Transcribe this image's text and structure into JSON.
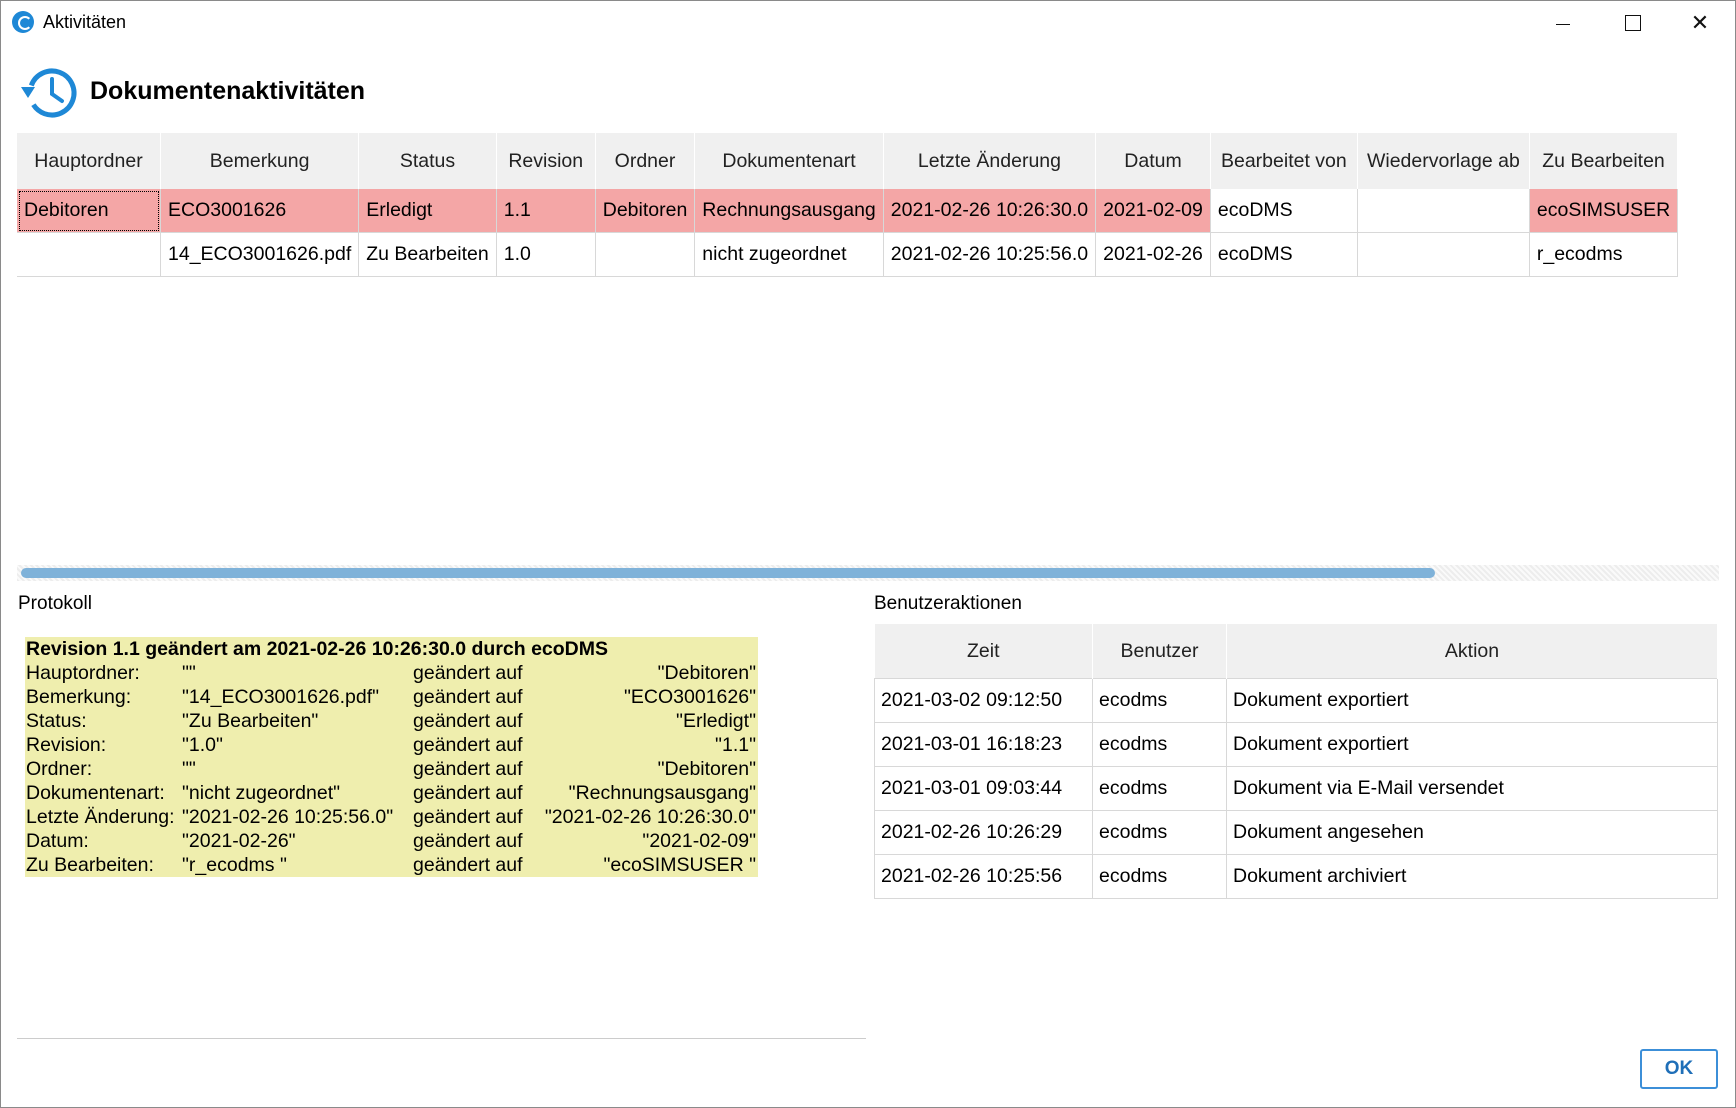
{
  "window": {
    "title": "Aktivitäten"
  },
  "header": {
    "title": "Dokumentenaktivitäten"
  },
  "main_table": {
    "columns": [
      "Hauptordner",
      "Bemerkung",
      "Status",
      "Revision",
      "Ordner",
      "Dokumentenart",
      "Letzte Änderung",
      "Datum",
      "Bearbeitet von",
      "Wiedervorlage ab",
      "Zu Bearbeiten"
    ],
    "rows": [
      [
        "Debitoren",
        "ECO3001626",
        "Erledigt",
        "1.1",
        "Debitoren",
        "Rechnungsausgang",
        "2021-02-26 10:26:30.0",
        "2021-02-09",
        "ecoDMS",
        "",
        "ecoSIMSUSER"
      ],
      [
        "",
        "14_ECO3001626.pdf",
        "Zu Bearbeiten",
        "1.0",
        "",
        "nicht zugeordnet",
        "2021-02-26 10:25:56.0",
        "2021-02-26",
        "ecoDMS",
        "",
        "r_ecodms"
      ]
    ],
    "highlight_color": "#f4a6a6"
  },
  "scrollbar": {
    "position_fraction": 0.835
  },
  "protokoll": {
    "label": "Protokoll",
    "title": "Revision 1.1 geändert am 2021-02-26 10:26:30.0 durch ecoDMS",
    "rows": [
      [
        "Hauptordner:",
        "\"\"",
        "geändert auf",
        "\"Debitoren\""
      ],
      [
        "Bemerkung:",
        "\"14_ECO3001626.pdf\"",
        "geändert auf",
        "\"ECO3001626\""
      ],
      [
        "Status:",
        "\"Zu Bearbeiten\"",
        "geändert auf",
        "\"Erledigt\""
      ],
      [
        "Revision:",
        "\"1.0\"",
        "geändert auf",
        "\"1.1\""
      ],
      [
        "Ordner:",
        "\"\"",
        "geändert auf",
        "\"Debitoren\""
      ],
      [
        "Dokumentenart:",
        "\"nicht zugeordnet\"",
        "geändert auf",
        "\"Rechnungsausgang\""
      ],
      [
        "Letzte Änderung:",
        "\"2021-02-26 10:25:56.0\"",
        "geändert auf",
        "\"2021-02-26 10:26:30.0\""
      ],
      [
        "Datum:",
        "\"2021-02-26\"",
        "geändert auf",
        "\"2021-02-09\""
      ],
      [
        "Zu Bearbeiten:",
        "\"r_ecodms \"",
        "geändert auf",
        "\"ecoSIMSUSER \""
      ]
    ],
    "background": "#efeeae"
  },
  "benutzeraktionen": {
    "label": "Benutzeraktionen",
    "columns": [
      "Zeit",
      "Benutzer",
      "Aktion"
    ],
    "rows": [
      [
        "2021-03-02 09:12:50",
        "ecodms",
        "Dokument exportiert"
      ],
      [
        "2021-03-01 16:18:23",
        "ecodms",
        "Dokument exportiert"
      ],
      [
        "2021-03-01 09:03:44",
        "ecodms",
        "Dokument via E-Mail versendet"
      ],
      [
        "2021-02-26 10:26:29",
        "ecodms",
        "Dokument angesehen"
      ],
      [
        "2021-02-26 10:25:56",
        "ecodms",
        "Dokument archiviert"
      ]
    ]
  },
  "buttons": {
    "ok": "OK"
  },
  "icons": {
    "app": "ecodms-app-icon",
    "history": "history-clock-icon",
    "accent": "#1e88d6"
  }
}
